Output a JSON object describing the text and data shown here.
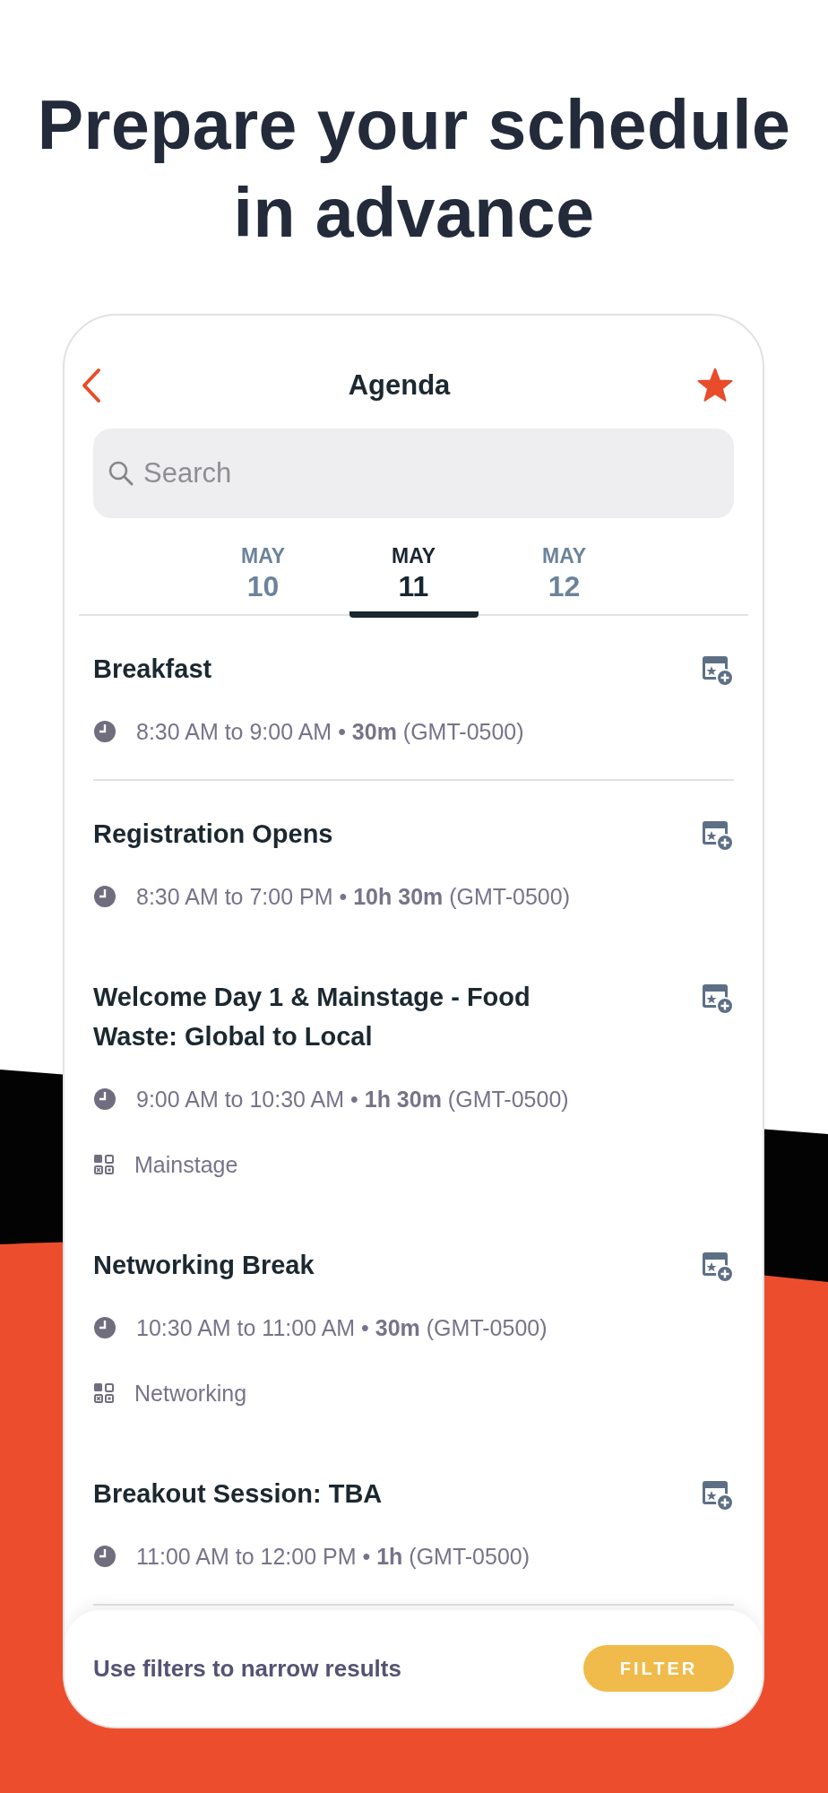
{
  "headline": [
    "Prepare your schedule",
    "in advance"
  ],
  "header": {
    "title": "Agenda",
    "favorite": true
  },
  "search": {
    "placeholder": "Search"
  },
  "days": [
    {
      "month": "MAY",
      "day": "10",
      "selected": false
    },
    {
      "month": "MAY",
      "day": "11",
      "selected": true
    },
    {
      "month": "MAY",
      "day": "12",
      "selected": false
    }
  ],
  "events": [
    {
      "kind": "event",
      "title": "Breakfast",
      "time": "8:30 AM to 9:00 AM • **30m** (GMT-0500)"
    },
    {
      "kind": "divider"
    },
    {
      "kind": "event",
      "title": "Registration Opens",
      "time": "8:30 AM to 7:00 PM • **10h 30m** (GMT-0500)"
    },
    {
      "kind": "event",
      "title": "Welcome Day 1 & Mainstage - Food Waste: Global to Local",
      "time": "9:00 AM to 10:30 AM • **1h 30m** (GMT-0500)",
      "location": "Mainstage"
    },
    {
      "kind": "event",
      "title": "Networking Break",
      "time": "10:30 AM to 11:00 AM • **30m** (GMT-0500)",
      "location": "Networking"
    },
    {
      "kind": "event",
      "title": "Breakout Session: TBA",
      "time": "11:00 AM to 12:00 PM • **1h** (GMT-0500)"
    },
    {
      "kind": "divider"
    }
  ],
  "filter_bar": {
    "hint": "Use filters to narrow results",
    "button": "FILTER"
  }
}
